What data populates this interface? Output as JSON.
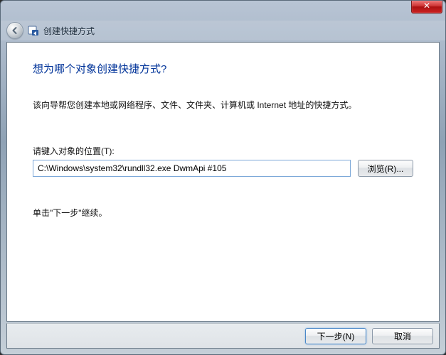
{
  "window": {
    "title": "创建快捷方式",
    "close_glyph": "✕"
  },
  "page": {
    "heading": "想为哪个对象创建快捷方式?",
    "description": "该向导帮您创建本地或网络程序、文件、文件夹、计算机或 Internet 地址的快捷方式。",
    "location_label": "请键入对象的位置(T):",
    "location_value": "C:\\Windows\\system32\\rundll32.exe DwmApi #105",
    "browse_label": "浏览(R)...",
    "hint": "单击\"下一步\"继续。"
  },
  "footer": {
    "next_label": "下一步(N)",
    "cancel_label": "取消"
  }
}
